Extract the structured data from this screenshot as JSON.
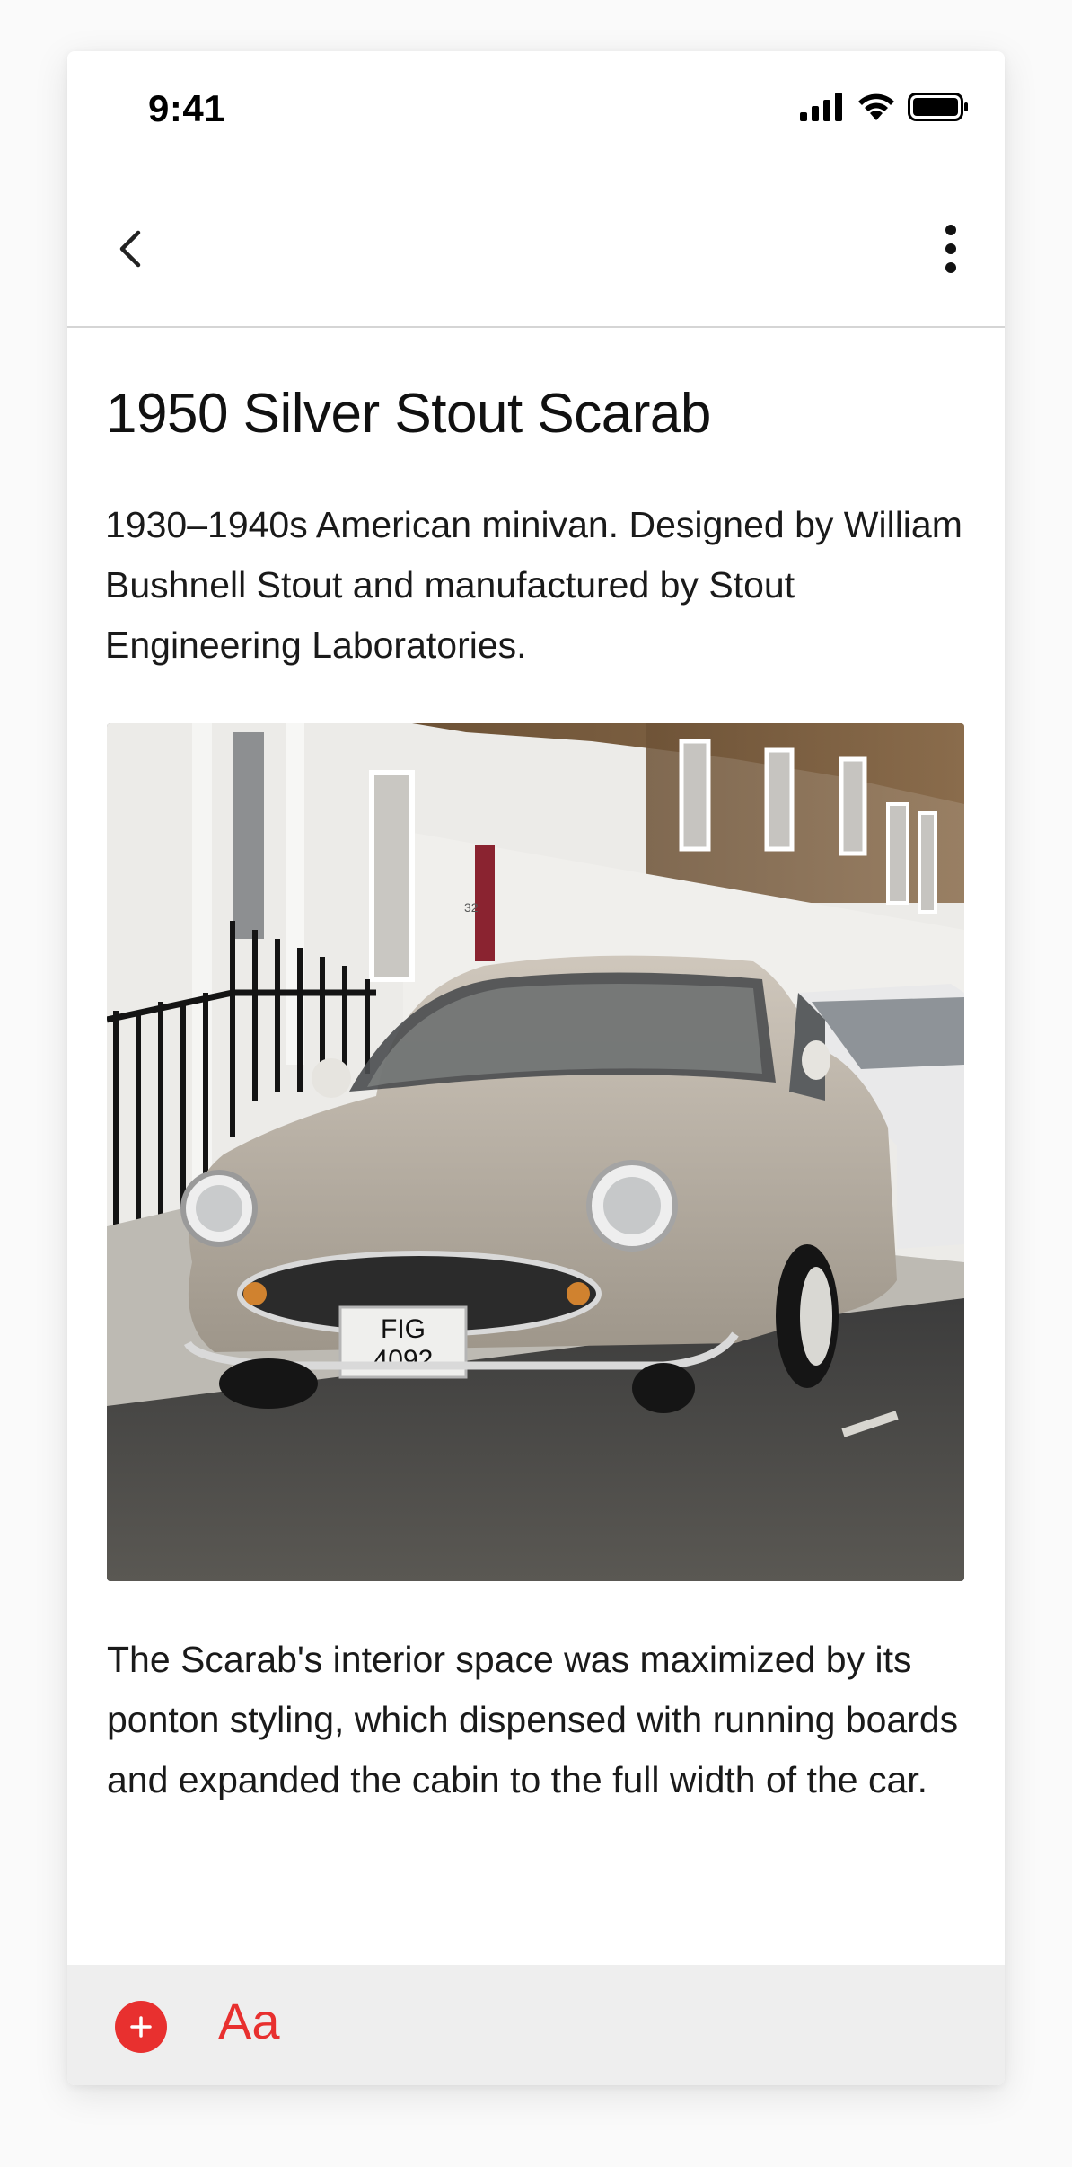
{
  "status_bar": {
    "time": "9:41",
    "icons": [
      "signal-icon",
      "wifi-icon",
      "battery-icon"
    ]
  },
  "nav": {
    "back_icon": "chevron-left-icon",
    "more_icon": "vertical-ellipsis-icon"
  },
  "article": {
    "title": "1950 Silver Stout Scarab",
    "intro": "1930–1940s American minivan. Designed by William Bushnell Stout and manufactured by Stout Engineering Laboratories.",
    "photo": {
      "plate_line1": "FIG",
      "plate_line2": "4092",
      "door_number": "32"
    },
    "body": "The Scarab's interior space was maximized by its ponton styling, which dispensed with running boards and expanded the cabin to the full width of the car."
  },
  "toolbar": {
    "add_icon": "plus-icon",
    "format_label": "Aa",
    "accent_color": "#e8302f"
  }
}
